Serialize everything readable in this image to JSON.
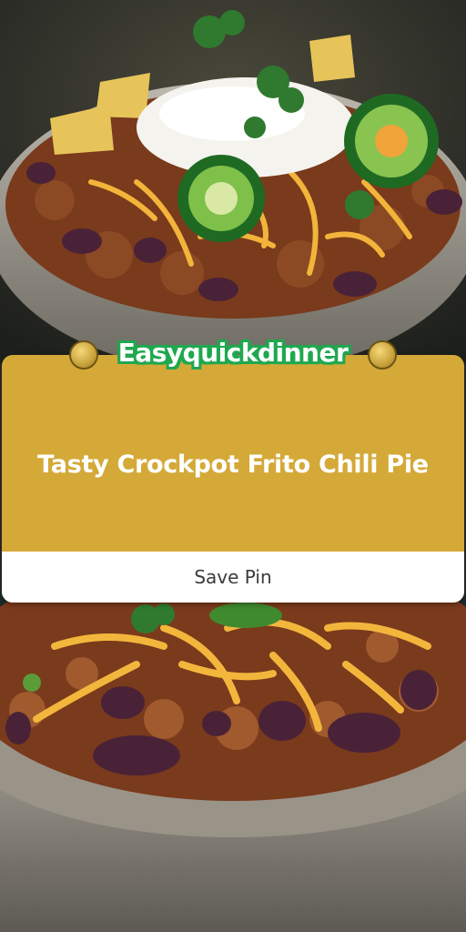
{
  "brand": {
    "name": "Easyquickdinner"
  },
  "pin_card": {
    "title": "Tasty Crockpot Frito Chili Pie",
    "save_label": "Save Pin",
    "accent_color": "#d4a938",
    "brand_color": "#1fa84f"
  },
  "images": {
    "top": "chili-bowl-with-sour-cream-jalapeno-image",
    "bottom": "chili-bowl-with-cheese-beans-image"
  }
}
